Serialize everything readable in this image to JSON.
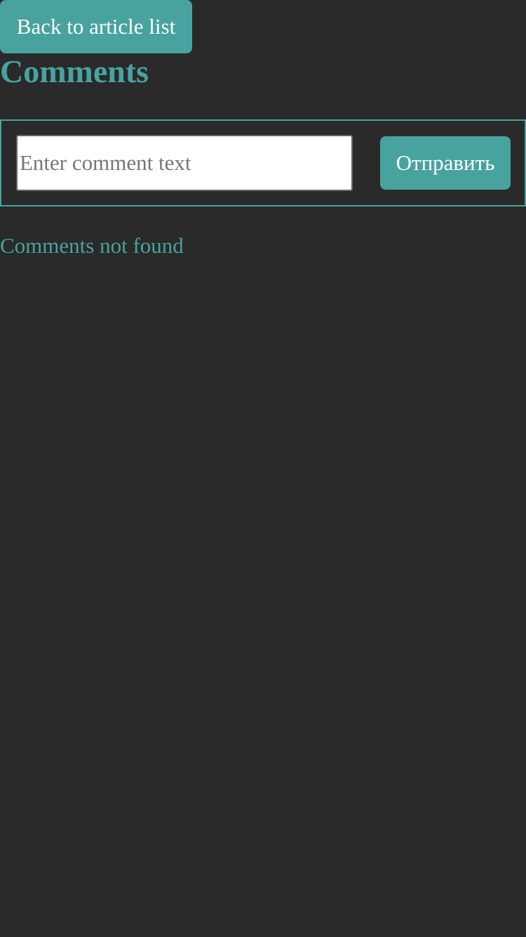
{
  "navigation": {
    "back_label": "Back to article list"
  },
  "comments": {
    "title": "Comments",
    "form": {
      "input_value": "",
      "input_placeholder": "Enter comment text",
      "submit_label": "Отправить"
    },
    "empty_message": "Comments not found"
  },
  "colors": {
    "background": "#2a2a2a",
    "accent": "#48a39f",
    "button_text": "#ffffff",
    "input_background": "#ffffff",
    "placeholder_text": "#777777"
  }
}
